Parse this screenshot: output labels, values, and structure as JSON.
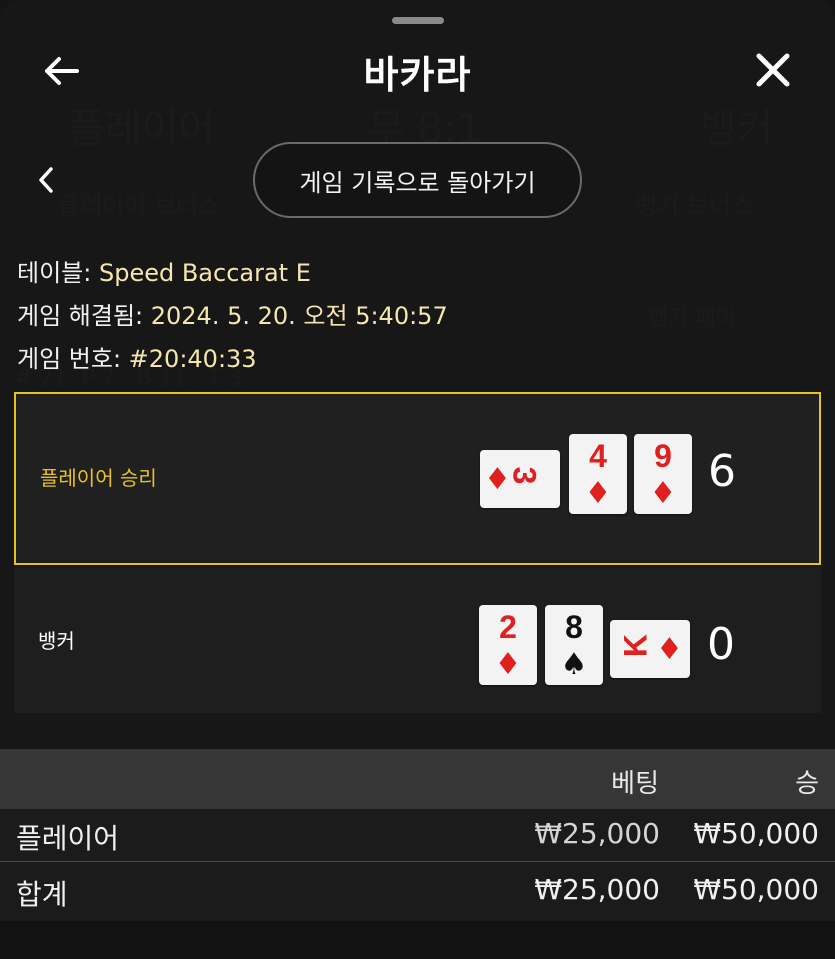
{
  "header": {
    "title": "바카라"
  },
  "nav": {
    "history_button_label": "게임 기록으로 돌아가기"
  },
  "info": {
    "table_label": "테이블: ",
    "table_value": "Speed Baccarat E",
    "resolved_label": "게임 해결됨: ",
    "resolved_value": "2024. 5. 20. 오전 5:40:57",
    "game_number_label": "게임 번호: ",
    "game_number_value": "#20:40:33"
  },
  "results": {
    "player": {
      "label": "플레이어 승리",
      "score": "6",
      "cards": [
        {
          "rank": "3",
          "suit": "♦",
          "color": "red",
          "orientation": "sideways"
        },
        {
          "rank": "4",
          "suit": "♦",
          "color": "red",
          "orientation": "upright"
        },
        {
          "rank": "9",
          "suit": "♦",
          "color": "red",
          "orientation": "upright"
        }
      ]
    },
    "banker": {
      "label": "뱅커",
      "score": "0",
      "cards": [
        {
          "rank": "2",
          "suit": "♦",
          "color": "red",
          "orientation": "upright"
        },
        {
          "rank": "8",
          "suit": "♠",
          "color": "black",
          "orientation": "upright"
        },
        {
          "rank": "K",
          "suit": "♦",
          "color": "red",
          "orientation": "sideways"
        }
      ]
    }
  },
  "bets_table": {
    "headers": {
      "bet": "베팅",
      "win": "승"
    },
    "rows": [
      {
        "name": "플레이어",
        "bet": "₩25,000",
        "win": "₩50,000"
      }
    ],
    "total": {
      "name": "합계",
      "bet": "₩25,000",
      "win": "₩50,000"
    }
  },
  "colors": {
    "winner_accent": "#e6c229",
    "card_red": "#e0201f",
    "info_value": "#f5e6b0"
  }
}
